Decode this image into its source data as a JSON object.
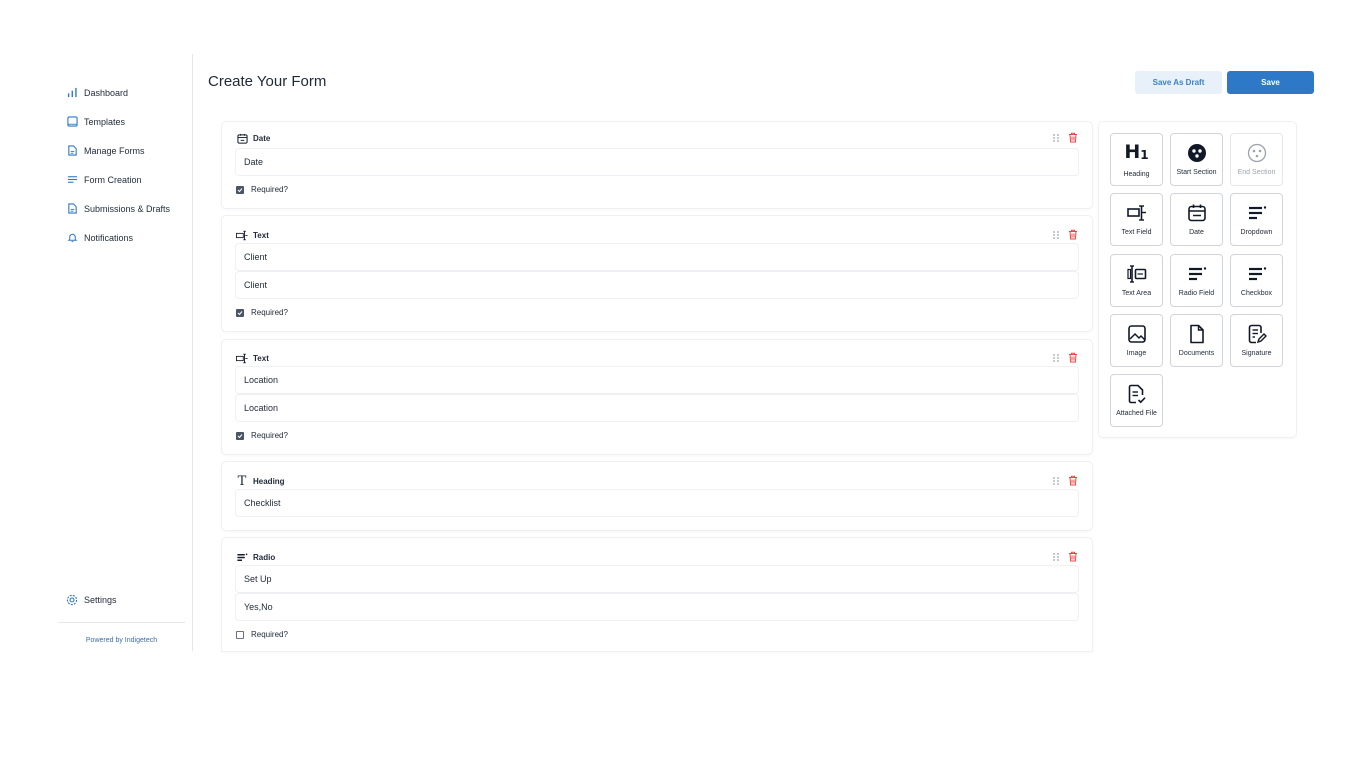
{
  "sidebar": {
    "items": [
      {
        "label": "Dashboard",
        "icon": "bar-chart-icon"
      },
      {
        "label": "Templates",
        "icon": "template-icon"
      },
      {
        "label": "Manage Forms",
        "icon": "document-icon"
      },
      {
        "label": "Form Creation",
        "icon": "list-icon"
      },
      {
        "label": "Submissions & Drafts",
        "icon": "document-icon"
      },
      {
        "label": "Notifications",
        "icon": "bell-icon"
      }
    ],
    "settings_label": "Settings",
    "powered_by": "Powered by Indigetech"
  },
  "header": {
    "title": "Create Your Form",
    "save_draft_label": "Save As Draft",
    "save_label": "Save"
  },
  "fields": [
    {
      "type_label": "Date",
      "icon": "calendar-icon",
      "inputs": [
        "Date"
      ],
      "required_label": "Required?",
      "required": true
    },
    {
      "type_label": "Text",
      "icon": "text-field-icon",
      "inputs": [
        "Client",
        "Client"
      ],
      "required_label": "Required?",
      "required": true
    },
    {
      "type_label": "Text",
      "icon": "text-field-icon",
      "inputs": [
        "Location",
        "Location"
      ],
      "required_label": "Required?",
      "required": true
    },
    {
      "type_label": "Heading",
      "icon": "heading-t-icon",
      "inputs": [
        "Checklist"
      ],
      "required_label": "",
      "required": null
    },
    {
      "type_label": "Radio",
      "icon": "radio-lines-icon",
      "inputs": [
        "Set Up",
        "Yes,No"
      ],
      "required_label": "Required?",
      "required": false
    }
  ],
  "palette": {
    "tiles": [
      {
        "label": "Heading",
        "icon": "h1-icon",
        "enabled": true
      },
      {
        "label": "Start Section",
        "icon": "start-section-icon",
        "enabled": true
      },
      {
        "label": "End Section",
        "icon": "end-section-icon",
        "enabled": false
      },
      {
        "label": "Text Field",
        "icon": "text-field-icon",
        "enabled": true
      },
      {
        "label": "Date",
        "icon": "calendar-icon",
        "enabled": true
      },
      {
        "label": "Dropdown",
        "icon": "dropdown-icon",
        "enabled": true
      },
      {
        "label": "Text Area",
        "icon": "text-area-icon",
        "enabled": true
      },
      {
        "label": "Radio Field",
        "icon": "radio-lines-icon",
        "enabled": true
      },
      {
        "label": "Checkbox",
        "icon": "checkbox-lines-icon",
        "enabled": true
      },
      {
        "label": "Image",
        "icon": "image-icon",
        "enabled": true
      },
      {
        "label": "Documents",
        "icon": "document-icon",
        "enabled": true
      },
      {
        "label": "Signature",
        "icon": "signature-icon",
        "enabled": true
      },
      {
        "label": "Attached File",
        "icon": "attached-file-icon",
        "enabled": true
      }
    ]
  },
  "colors": {
    "primary": "#2d79c7",
    "draft_bg": "#e8f1fa",
    "delete": "#ef4444"
  }
}
